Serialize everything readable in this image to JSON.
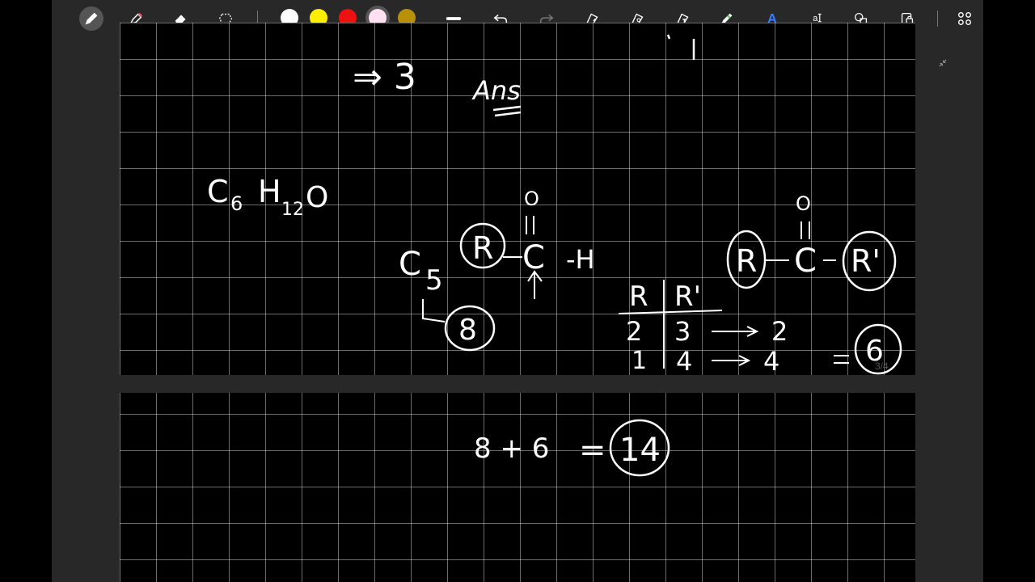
{
  "toolbar": {
    "tools": [
      "pen-tool",
      "highlighter-tool",
      "eraser-tool",
      "lasso-tool"
    ],
    "colors": [
      "#ffffff",
      "#ffee00",
      "#ee1111",
      "#ffe0f0",
      "#b8900a"
    ],
    "selected_color": "#ffe0f0",
    "accent": "#3a7bff"
  },
  "page1": {
    "line1": "⇒ 3",
    "ans": "Ans",
    "formula_c": "C",
    "formula_6": "6",
    "formula_h": "H",
    "formula_12": "12",
    "formula_o": "O",
    "aldehyde_o": "O",
    "aldehyde_c5": "C",
    "aldehyde_5": "5",
    "aldehyde_r": "R",
    "aldehyde_c": "C",
    "aldehyde_h": "-H",
    "aldehyde_count": "8",
    "ketone_o": "O",
    "ketone_r": "R",
    "ketone_c": "C",
    "ketone_r1": "R'",
    "table_r": "R",
    "table_r1": "R'",
    "row1_r": "2",
    "row1_r1": "3",
    "row1_result": "2",
    "row2_r": "1",
    "row2_r1": "4",
    "row2_result": "4",
    "ketone_total": "6",
    "page_indicator": "3/4"
  },
  "page2": {
    "sum": "8 + 6",
    "equals": "=",
    "total": "14"
  }
}
